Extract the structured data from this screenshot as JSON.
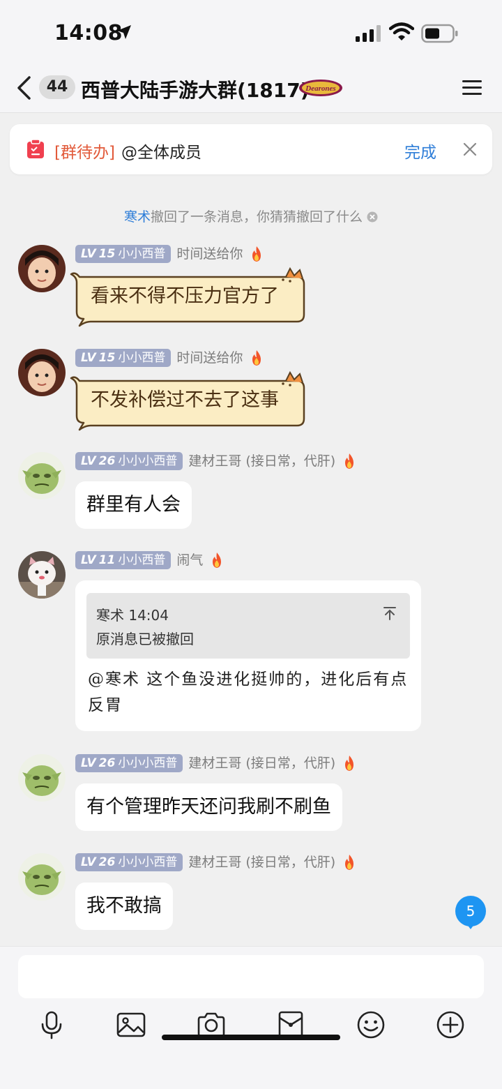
{
  "status_bar": {
    "time": "14:08"
  },
  "header": {
    "unread_count": "44",
    "title": "西普大陆手游大群(1817)",
    "badge_label": "Dearones"
  },
  "todo": {
    "tag": "[群待办]",
    "text": "@全体成员",
    "done_label": "完成"
  },
  "system_notice": {
    "name": "寒术",
    "text": "撤回了一条消息，你猜猜撤回了什么"
  },
  "messages": [
    {
      "level": "15",
      "level_prefix": "LV",
      "group_nick": "小小西普",
      "sender": "时间送给你",
      "text": "看来不得不压力官方了"
    },
    {
      "level": "15",
      "level_prefix": "LV",
      "group_nick": "小小西普",
      "sender": "时间送给你",
      "text": "不发补偿过不去了这事"
    },
    {
      "level": "26",
      "level_prefix": "LV",
      "group_nick": "小小小西普",
      "sender": "建材王哥 (接日常，代肝)",
      "text": "群里有人会"
    },
    {
      "level": "11",
      "level_prefix": "LV",
      "group_nick": "小小西普",
      "sender": "闹气",
      "quote": {
        "author_time": "寒术 14:04",
        "body": "原消息已被撤回"
      },
      "text": "@寒术 这个鱼没进化挺帅的，进化后有点反胃"
    },
    {
      "level": "26",
      "level_prefix": "LV",
      "group_nick": "小小小西普",
      "sender": "建材王哥 (接日常，代肝)",
      "text": "有个管理昨天还问我刷不刷鱼"
    },
    {
      "level": "26",
      "level_prefix": "LV",
      "group_nick": "小小小西普",
      "sender": "建材王哥 (接日常，代肝)",
      "text": "我不敢搞"
    }
  ],
  "new_message_badge": "5",
  "input": {
    "placeholder": ""
  },
  "toolbar_icons": [
    "microphone-icon",
    "image-icon",
    "camera-icon",
    "red-packet-icon",
    "emoji-icon",
    "plus-icon"
  ],
  "colors": {
    "accent": "#2f7ed8",
    "todo_tag": "#e25a3a",
    "level_badge": "#9fa8c7",
    "unread_badge": "#1e95f2",
    "cat_bubble": "#fbedc4"
  }
}
